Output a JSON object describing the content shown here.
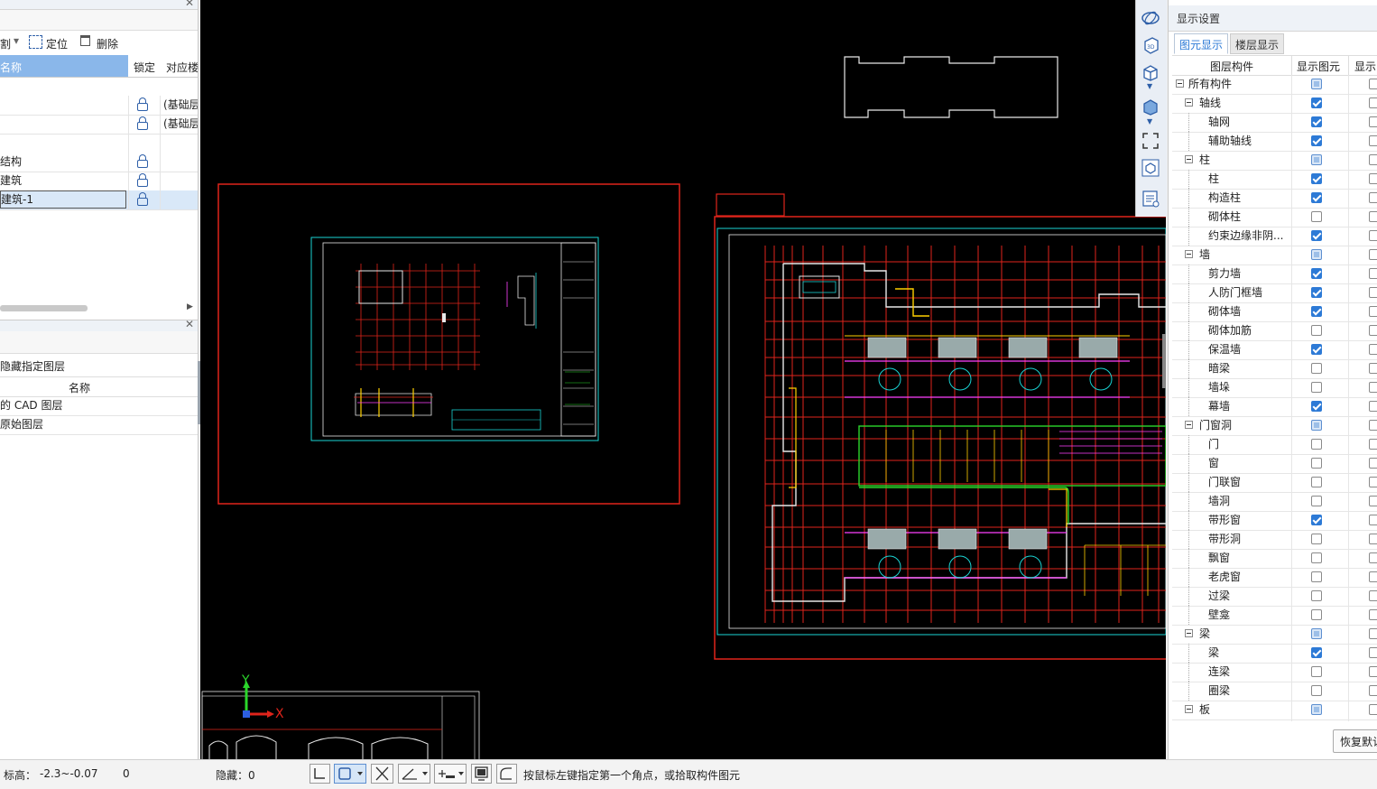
{
  "left_panel": {
    "toolbar": {
      "split_label": "割",
      "locate_label": "定位",
      "delete_label": "删除"
    },
    "table_headers": {
      "name": "名称",
      "lock": "锁定",
      "floor": "对应楼"
    },
    "rows": [
      {
        "name": "",
        "floor": "(基础层"
      },
      {
        "name": "",
        "floor": "(基础层"
      },
      {
        "name": "结构",
        "floor": ""
      },
      {
        "name": "建筑",
        "floor": ""
      },
      {
        "name": "建筑-1",
        "floor": ""
      }
    ],
    "layer_section": {
      "hide_label": "隐藏指定图层",
      "name_header": "名称",
      "items": [
        "的 CAD 图层",
        "原始图层"
      ]
    }
  },
  "canvas": {
    "axis_y": "Y",
    "axis_x": "X"
  },
  "right_panel": {
    "title": "显示设置",
    "tabs": [
      "图元显示",
      "楼层显示"
    ],
    "headers": {
      "layer_component": "图层构件",
      "show_element": "显示图元",
      "show_name": "显示"
    },
    "tree": [
      {
        "label": "所有构件",
        "level": 0,
        "group": true,
        "state": "partial"
      },
      {
        "label": "轴线",
        "level": 1,
        "group": true,
        "state": "checked"
      },
      {
        "label": "轴网",
        "level": 2,
        "group": false,
        "state": "checked"
      },
      {
        "label": "辅助轴线",
        "level": 2,
        "group": false,
        "state": "checked"
      },
      {
        "label": "柱",
        "level": 1,
        "group": true,
        "state": "partial"
      },
      {
        "label": "柱",
        "level": 2,
        "group": false,
        "state": "checked"
      },
      {
        "label": "构造柱",
        "level": 2,
        "group": false,
        "state": "checked"
      },
      {
        "label": "砌体柱",
        "level": 2,
        "group": false,
        "state": "unchecked"
      },
      {
        "label": "约束边缘非阴...",
        "level": 2,
        "group": false,
        "state": "checked"
      },
      {
        "label": "墙",
        "level": 1,
        "group": true,
        "state": "partial"
      },
      {
        "label": "剪力墙",
        "level": 2,
        "group": false,
        "state": "checked"
      },
      {
        "label": "人防门框墙",
        "level": 2,
        "group": false,
        "state": "checked"
      },
      {
        "label": "砌体墙",
        "level": 2,
        "group": false,
        "state": "checked"
      },
      {
        "label": "砌体加筋",
        "level": 2,
        "group": false,
        "state": "unchecked"
      },
      {
        "label": "保温墙",
        "level": 2,
        "group": false,
        "state": "checked"
      },
      {
        "label": "暗梁",
        "level": 2,
        "group": false,
        "state": "unchecked"
      },
      {
        "label": "墙垛",
        "level": 2,
        "group": false,
        "state": "unchecked"
      },
      {
        "label": "幕墙",
        "level": 2,
        "group": false,
        "state": "checked"
      },
      {
        "label": "门窗洞",
        "level": 1,
        "group": true,
        "state": "partial"
      },
      {
        "label": "门",
        "level": 2,
        "group": false,
        "state": "unchecked"
      },
      {
        "label": "窗",
        "level": 2,
        "group": false,
        "state": "unchecked"
      },
      {
        "label": "门联窗",
        "level": 2,
        "group": false,
        "state": "unchecked"
      },
      {
        "label": "墙洞",
        "level": 2,
        "group": false,
        "state": "unchecked"
      },
      {
        "label": "带形窗",
        "level": 2,
        "group": false,
        "state": "checked"
      },
      {
        "label": "带形洞",
        "level": 2,
        "group": false,
        "state": "unchecked"
      },
      {
        "label": "飘窗",
        "level": 2,
        "group": false,
        "state": "unchecked"
      },
      {
        "label": "老虎窗",
        "level": 2,
        "group": false,
        "state": "unchecked"
      },
      {
        "label": "过梁",
        "level": 2,
        "group": false,
        "state": "unchecked"
      },
      {
        "label": "壁龛",
        "level": 2,
        "group": false,
        "state": "unchecked"
      },
      {
        "label": "梁",
        "level": 1,
        "group": true,
        "state": "partial"
      },
      {
        "label": "梁",
        "level": 2,
        "group": false,
        "state": "checked"
      },
      {
        "label": "连梁",
        "level": 2,
        "group": false,
        "state": "unchecked"
      },
      {
        "label": "圈梁",
        "level": 2,
        "group": false,
        "state": "unchecked"
      },
      {
        "label": "板",
        "level": 1,
        "group": true,
        "state": "partial"
      }
    ],
    "restore_button": "恢复默认"
  },
  "status_bar": {
    "elevation_label": "标高：",
    "elevation_value": "-2.3~-0.07",
    "zero_value": "0",
    "hidden_label": "隐藏：0",
    "hint": "按鼠标左键指定第一个角点，或拾取构件图元"
  },
  "colors": {
    "accent": "#2d7ad6",
    "canvas_bg": "#000000",
    "selection_red": "#e0241b",
    "cad_cyan": "#1ad3d3",
    "header_blue": "#8ab7ea"
  }
}
